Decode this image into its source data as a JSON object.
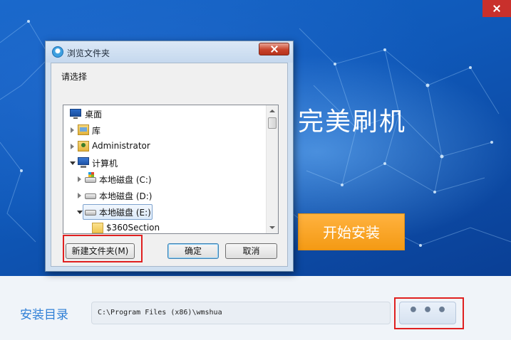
{
  "installer": {
    "app_title": "完美刷机",
    "install_button": "开始安装",
    "dir_label": "安装目录",
    "dir_value": "C:\\Program Files (x86)\\wmshua",
    "browse_button": "•••",
    "close_icon": "close-icon"
  },
  "dialog": {
    "title": "浏览文件夹",
    "prompt": "请选择",
    "tree": [
      {
        "label": "桌面",
        "icon": "desktop-icon",
        "expander": "none",
        "indent": 0
      },
      {
        "label": "库",
        "icon": "library-icon",
        "expander": "collapsed",
        "indent": 0
      },
      {
        "label": "Administrator",
        "icon": "user-folder-icon",
        "expander": "collapsed",
        "indent": 0
      },
      {
        "label": "计算机",
        "icon": "computer-icon",
        "expander": "expanded",
        "indent": 0
      },
      {
        "label": "本地磁盘 (C:)",
        "icon": "system-drive-icon",
        "expander": "collapsed",
        "indent": 1
      },
      {
        "label": "本地磁盘 (D:)",
        "icon": "drive-icon",
        "expander": "collapsed",
        "indent": 1
      },
      {
        "label": "本地磁盘 (E:)",
        "icon": "drive-icon",
        "expander": "expanded",
        "indent": 1,
        "selected": true
      },
      {
        "label": "$360Section",
        "icon": "folder-icon",
        "expander": "none",
        "indent": 2
      }
    ],
    "new_folder_button": "新建文件夹(M)",
    "ok_button": "确定",
    "cancel_button": "取消"
  },
  "colors": {
    "banner_blue": "#0f58b8",
    "install_orange": "#f49a14",
    "label_blue": "#2f7fd6",
    "highlight_red": "#e02020"
  }
}
